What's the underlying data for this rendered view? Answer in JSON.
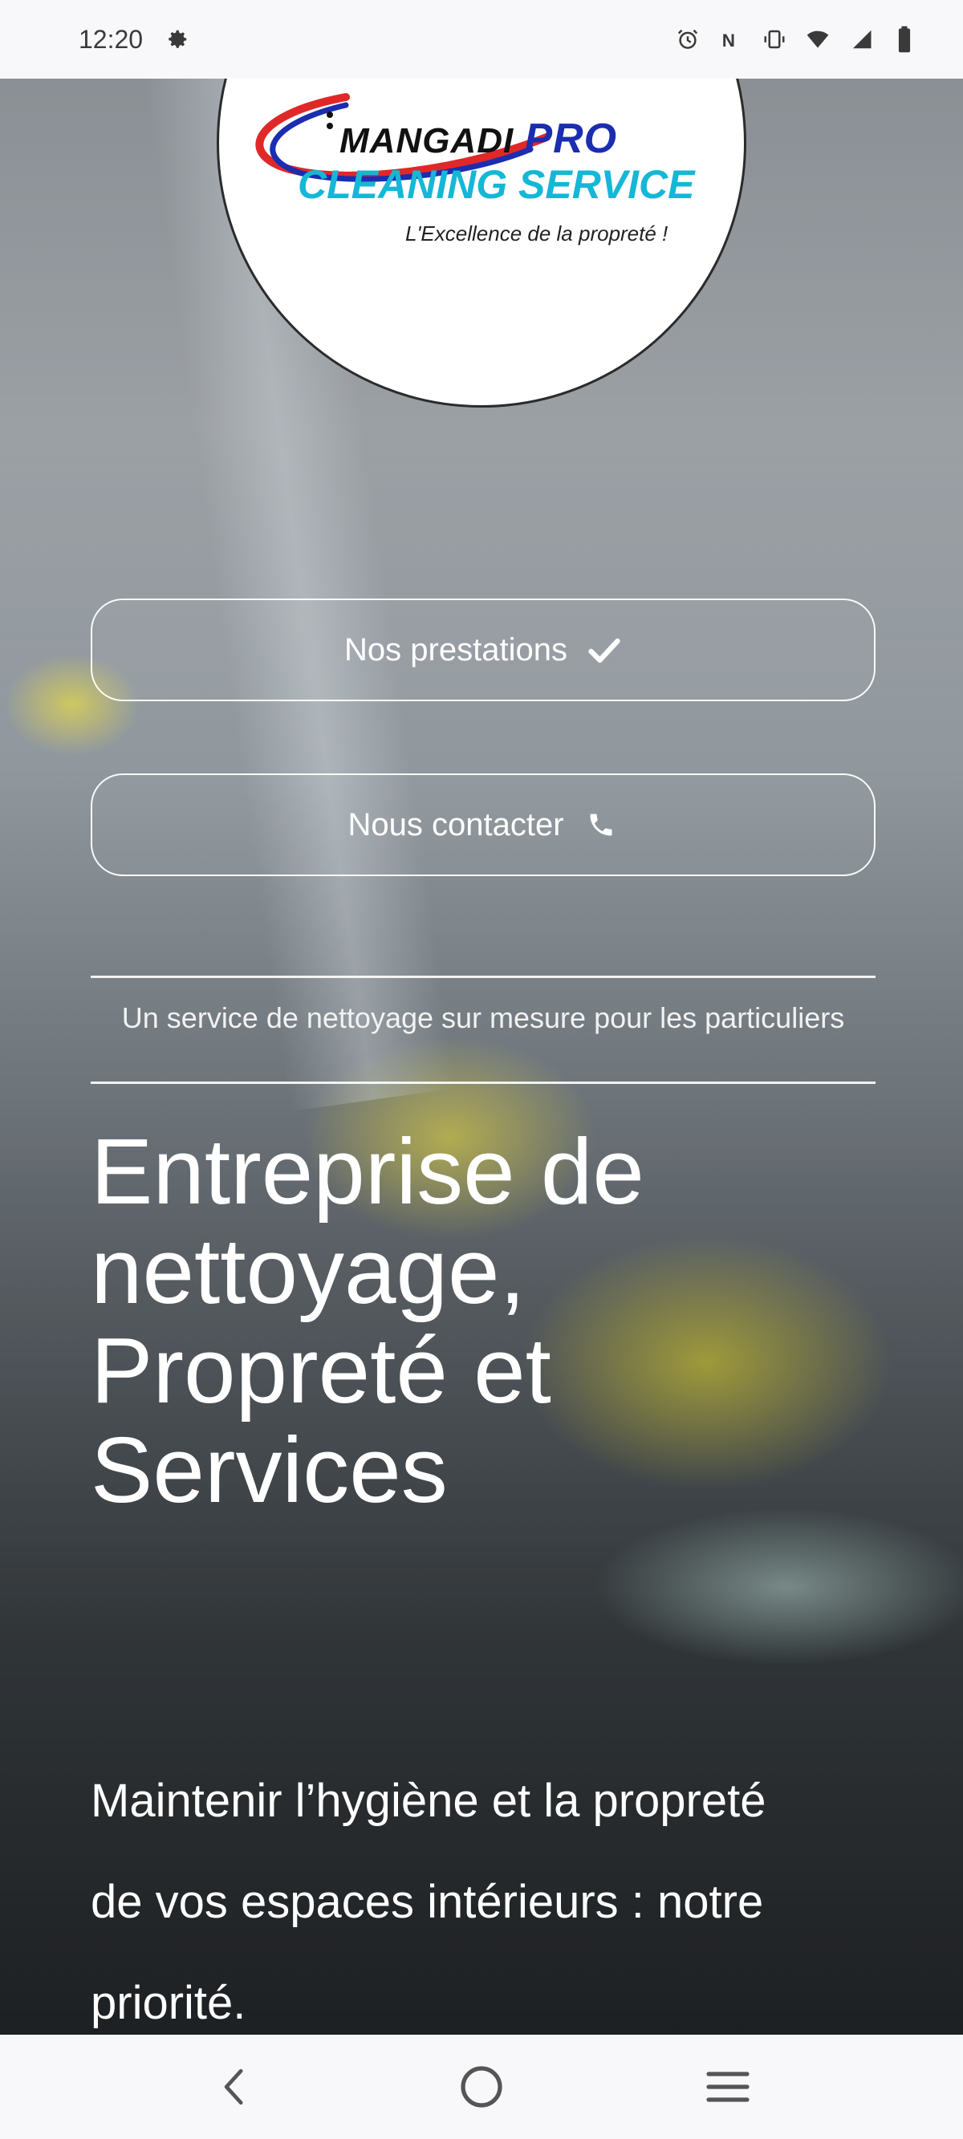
{
  "status_bar": {
    "time": "12:20",
    "icons": [
      "settings-gear-icon",
      "alarm-icon",
      "nfc-icon",
      "vibrate-icon",
      "wifi-icon",
      "signal-icon",
      "battery-icon"
    ]
  },
  "logo": {
    "line1_brand": "MANGADI",
    "line1_suffix": "PRO",
    "line2": "CLEANING SERVICE",
    "tagline": "L'Excellence de la propreté !",
    "colors": {
      "pro": "#1b2db0",
      "cleaning": "#15b7d6",
      "swoosh_red": "#e02828",
      "swoosh_blue": "#1b2db0"
    }
  },
  "actions": {
    "prestations_label": "Nos prestations",
    "prestations_icon": "check-icon",
    "contact_label": "Nous contacter",
    "contact_icon": "phone-icon"
  },
  "hero": {
    "tagline": "Un service de nettoyage sur mesure pour les particuliers",
    "headline_lines": [
      "Entreprise de",
      "nettoyage,",
      "Propreté et",
      "Services"
    ],
    "subheading_lines": [
      "Maintenir l’hygiène et la propreté",
      "de vos espaces intérieurs : notre",
      "priorité."
    ]
  },
  "nav_bar": {
    "icons": [
      "back-icon",
      "home-icon",
      "recents-icon"
    ]
  }
}
